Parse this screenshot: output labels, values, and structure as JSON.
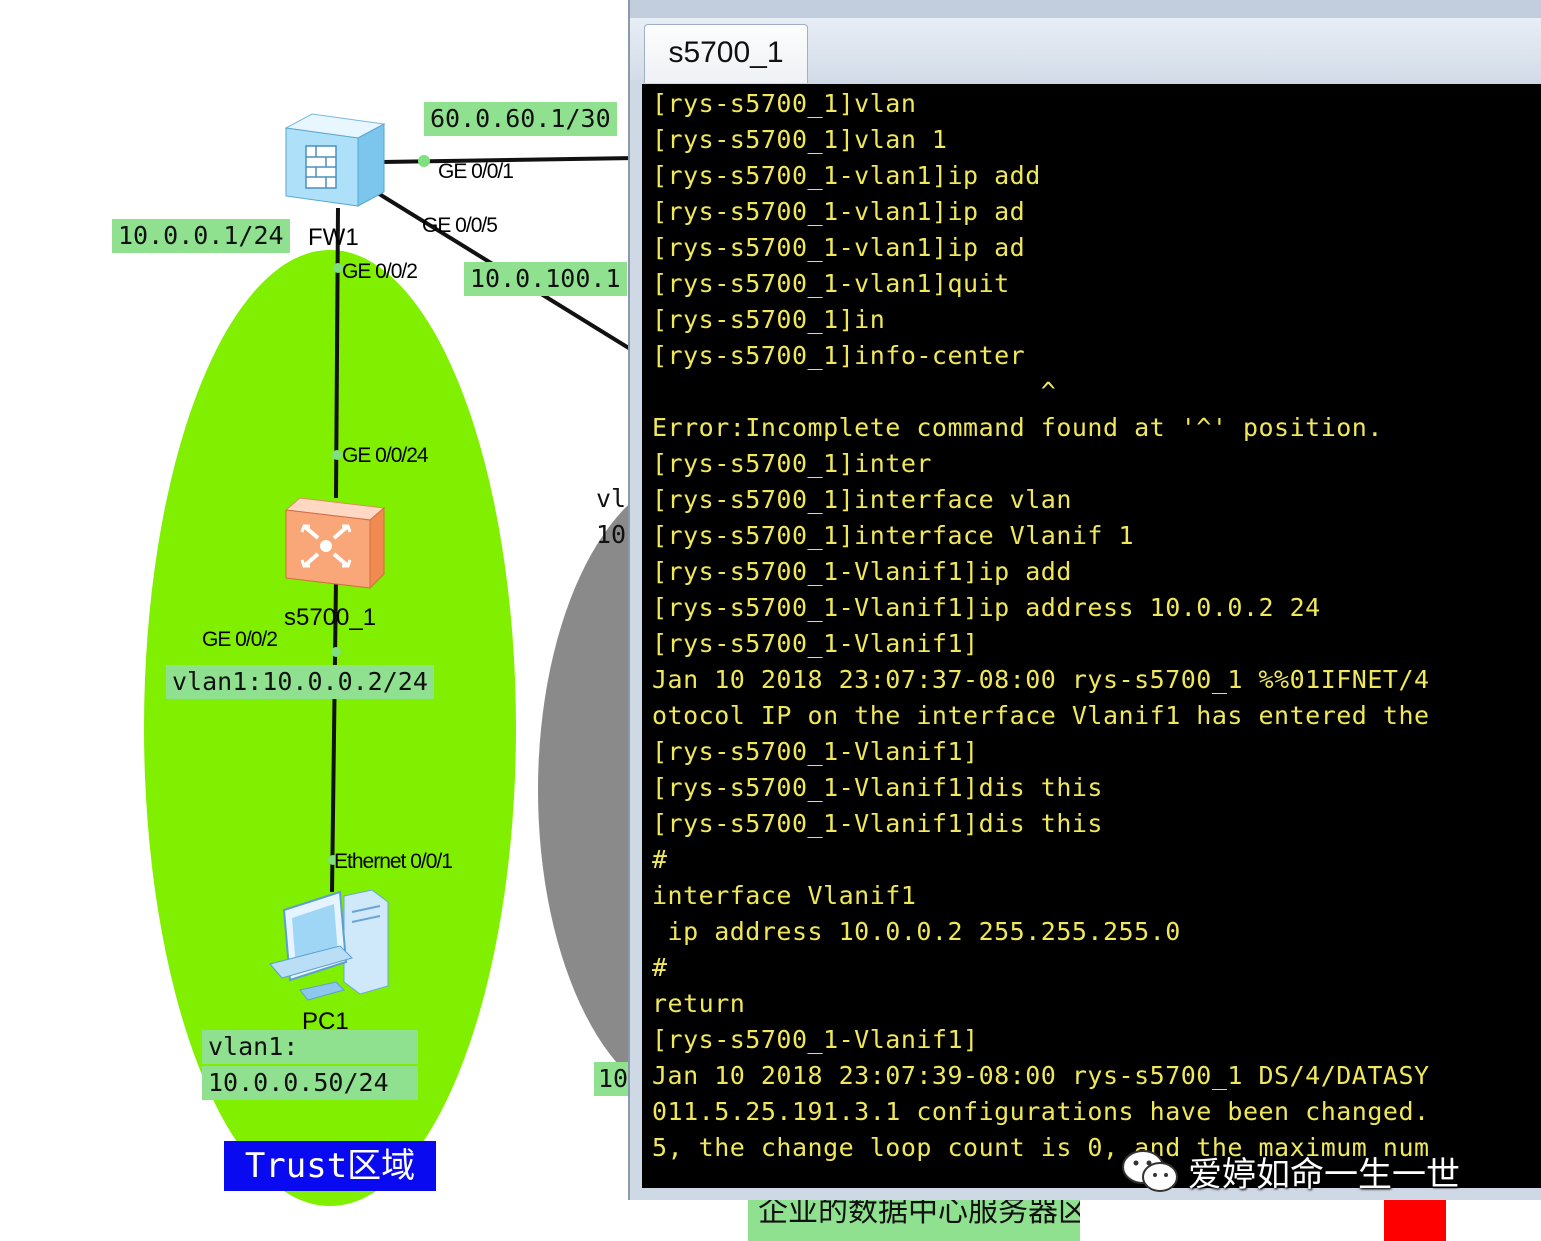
{
  "topology": {
    "labels": {
      "fw_outside_ip": "60.0.60.1/30",
      "fw_inside_ip": "10.0.0.1/24",
      "dmz_ip_partial": "10.0.100.1",
      "switch_vlan_ip": "vlan1:10.0.0.2/24",
      "pc_vlan": "vlan1:",
      "pc_ip": "10.0.0.50/24",
      "server_partial_1": "vl",
      "server_partial_2": "10",
      "server_partial_3": "10"
    },
    "ports": {
      "fw_ge001": "GE 0/0/1",
      "fw_ge005": "GE 0/0/5",
      "fw_ge002": "GE 0/0/2",
      "sw_ge0024": "GE 0/0/24",
      "sw_ge002": "GE 0/0/2",
      "pc_eth": "Ethernet 0/0/1"
    },
    "devices": {
      "firewall": "FW1",
      "switch": "s5700_1",
      "pc": "PC1"
    },
    "zone_label": "Trust区域",
    "datacenter_label": "企业的数据中心服务器区域",
    "colors": {
      "trust_zone": "#80f000",
      "server_zone": "#8a8a8a",
      "label_bg": "#8fe08f",
      "zone_label_bg": "#0a0af0"
    }
  },
  "terminal": {
    "tab_label": "s5700_1",
    "text_color": "#f0e85a",
    "lines": [
      "[rys-s5700_1]vlan",
      "[rys-s5700_1]vlan 1",
      "[rys-s5700_1-vlan1]ip add",
      "[rys-s5700_1-vlan1]ip ad",
      "[rys-s5700_1-vlan1]ip ad",
      "[rys-s5700_1-vlan1]quit",
      "[rys-s5700_1]in",
      "[rys-s5700_1]info-center",
      "                         ^",
      "Error:Incomplete command found at '^' position.",
      "[rys-s5700_1]inter",
      "[rys-s5700_1]interface vlan",
      "[rys-s5700_1]interface Vlanif 1",
      "[rys-s5700_1-Vlanif1]ip add",
      "[rys-s5700_1-Vlanif1]ip address 10.0.0.2 24",
      "[rys-s5700_1-Vlanif1]",
      "Jan 10 2018 23:07:37-08:00 rys-s5700_1 %%01IFNET/4",
      "otocol IP on the interface Vlanif1 has entered the",
      "[rys-s5700_1-Vlanif1]",
      "[rys-s5700_1-Vlanif1]dis this",
      "[rys-s5700_1-Vlanif1]dis this",
      "#",
      "interface Vlanif1",
      " ip address 10.0.0.2 255.255.255.0",
      "#",
      "return",
      "[rys-s5700_1-Vlanif1]",
      "Jan 10 2018 23:07:39-08:00 rys-s5700_1 DS/4/DATASY",
      "011.5.25.191.3.1 configurations have been changed.",
      "5, the change loop count is 0, and the maximum num"
    ]
  },
  "watermark": {
    "icon": "wechat-icon",
    "text": "爱婷如命一生一世"
  }
}
